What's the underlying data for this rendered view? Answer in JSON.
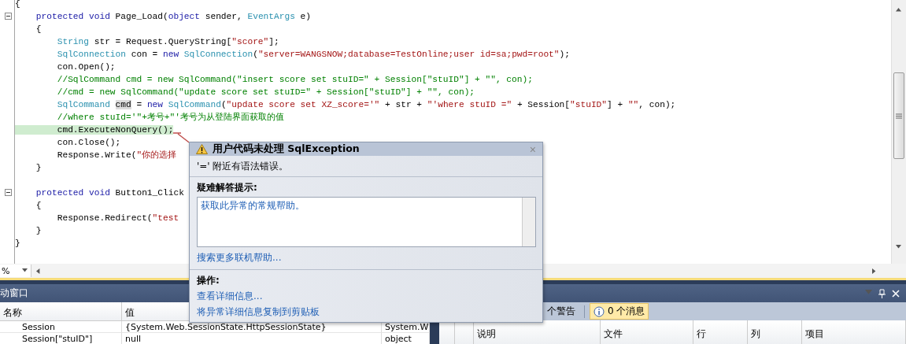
{
  "editor": {
    "lines": [
      {
        "kind": "plain",
        "tokens": [
          {
            "kind": "plain",
            "text": "{"
          }
        ]
      },
      {
        "kind": "fold_start",
        "expanded": true,
        "tokens": [
          {
            "kind": "kw",
            "text": "    protected"
          },
          {
            "kind": "kw",
            "text": " void"
          },
          {
            "kind": "plain",
            "text": " Page_Load("
          },
          {
            "kind": "kw",
            "text": "object"
          },
          {
            "kind": "plain",
            "text": " sender, "
          },
          {
            "kind": "type",
            "text": "EventArgs"
          },
          {
            "kind": "plain",
            "text": " e)"
          }
        ]
      },
      {
        "kind": "plain",
        "tokens": [
          {
            "kind": "plain",
            "text": "    {"
          }
        ]
      },
      {
        "kind": "plain",
        "tokens": [
          {
            "kind": "type",
            "text": "        String"
          },
          {
            "kind": "plain",
            "text": " str = Request.QueryString["
          },
          {
            "kind": "str",
            "text": "\"score\""
          },
          {
            "kind": "plain",
            "text": "];"
          }
        ]
      },
      {
        "kind": "plain",
        "tokens": [
          {
            "kind": "type",
            "text": "        SqlConnection"
          },
          {
            "kind": "plain",
            "text": " con = "
          },
          {
            "kind": "kw",
            "text": "new"
          },
          {
            "kind": "type",
            "text": " SqlConnection"
          },
          {
            "kind": "plain",
            "text": "("
          },
          {
            "kind": "str",
            "text": "\"server=WANGSNOW;database=TestOnline;user id=sa;pwd=root\""
          },
          {
            "kind": "plain",
            "text": ");"
          }
        ]
      },
      {
        "kind": "plain",
        "tokens": [
          {
            "kind": "plain",
            "text": "        con.Open();"
          }
        ]
      },
      {
        "kind": "plain",
        "tokens": [
          {
            "kind": "cmt",
            "text": "        //SqlCommand cmd = new SqlCommand(\"insert score set stuID=\" + Session[\"stuID\"] + \"\", con);"
          }
        ]
      },
      {
        "kind": "plain",
        "tokens": [
          {
            "kind": "cmt",
            "text": "        //cmd = new SqlCommand(\"update score set stuID=\" + Session[\"stuID\"] + \"\", con);"
          }
        ]
      },
      {
        "kind": "plain",
        "tokens": [
          {
            "kind": "type",
            "text": "        SqlCommand "
          },
          {
            "kind": "ref",
            "text": "cmd"
          },
          {
            "kind": "plain",
            "text": " = "
          },
          {
            "kind": "kw",
            "text": "new"
          },
          {
            "kind": "type",
            "text": " SqlCommand"
          },
          {
            "kind": "plain",
            "text": "("
          },
          {
            "kind": "str",
            "text": "\"update score set XZ_score='\""
          },
          {
            "kind": "plain",
            "text": " + str + "
          },
          {
            "kind": "str",
            "text": "\"'where stuID =\""
          },
          {
            "kind": "plain",
            "text": " + Session["
          },
          {
            "kind": "str",
            "text": "\"stuID\""
          },
          {
            "kind": "plain",
            "text": "] + "
          },
          {
            "kind": "str",
            "text": "\"\""
          },
          {
            "kind": "plain",
            "text": ", con);"
          }
        ]
      },
      {
        "kind": "plain",
        "tokens": [
          {
            "kind": "cmt",
            "text": "        //where stuId='\"+考号+\"'考号为从登陆界面获取的值"
          }
        ]
      },
      {
        "kind": "plain",
        "highlighted": true,
        "tokens": [
          {
            "kind": "plain",
            "text": "        cmd.ExecuteNonQuery();"
          }
        ]
      },
      {
        "kind": "plain",
        "tokens": [
          {
            "kind": "plain",
            "text": "        con.Close();"
          }
        ]
      },
      {
        "kind": "plain",
        "tokens": [
          {
            "kind": "plain",
            "text": "        Response.Write("
          },
          {
            "kind": "str",
            "text": "\"你的选择"
          }
        ]
      },
      {
        "kind": "plain",
        "tokens": [
          {
            "kind": "plain",
            "text": "    }"
          }
        ]
      },
      {
        "kind": "blank"
      },
      {
        "kind": "fold_start",
        "expanded": true,
        "tokens": [
          {
            "kind": "kw",
            "text": "    protected"
          },
          {
            "kind": "kw",
            "text": " void"
          },
          {
            "kind": "plain",
            "text": " Button1_Click"
          }
        ]
      },
      {
        "kind": "plain",
        "tokens": [
          {
            "kind": "plain",
            "text": "    {"
          }
        ]
      },
      {
        "kind": "plain",
        "tokens": [
          {
            "kind": "plain",
            "text": "        Response.Redirect("
          },
          {
            "kind": "str",
            "text": "\"test"
          }
        ]
      },
      {
        "kind": "plain",
        "tokens": [
          {
            "kind": "plain",
            "text": "    }"
          }
        ]
      },
      {
        "kind": "plain",
        "tokens": [
          {
            "kind": "plain",
            "text": "}"
          }
        ]
      }
    ],
    "zoom": "%"
  },
  "exception_popup": {
    "title": "用户代码未处理 SqlException",
    "close": "×",
    "message": "'=' 附近有语法错误。",
    "tips_heading": "疑难解答提示:",
    "tips": [
      "获取此异常的常规帮助。"
    ],
    "search_link": "搜索更多联机帮助...",
    "actions_heading": "操作:",
    "actions": [
      "查看详细信息...",
      "将异常详细信息复制到剪贴板"
    ]
  },
  "autos_panel": {
    "title": "动窗口",
    "columns": [
      "名称",
      "值"
    ],
    "rows": [
      {
        "name": "Session",
        "value": "{System.Web.SessionState.HttpSessionState}",
        "type": "System.W"
      },
      {
        "name": "Session[\"stuID\"]",
        "value": "null",
        "type": "object"
      }
    ]
  },
  "error_panel": {
    "toolbar": [
      {
        "label": "个警告",
        "kind": "warnings",
        "selected": false
      },
      {
        "label": "0 个消息",
        "kind": "messages",
        "selected": true
      }
    ],
    "columns": [
      "说明",
      "文件",
      "行",
      "列",
      "项目"
    ]
  }
}
